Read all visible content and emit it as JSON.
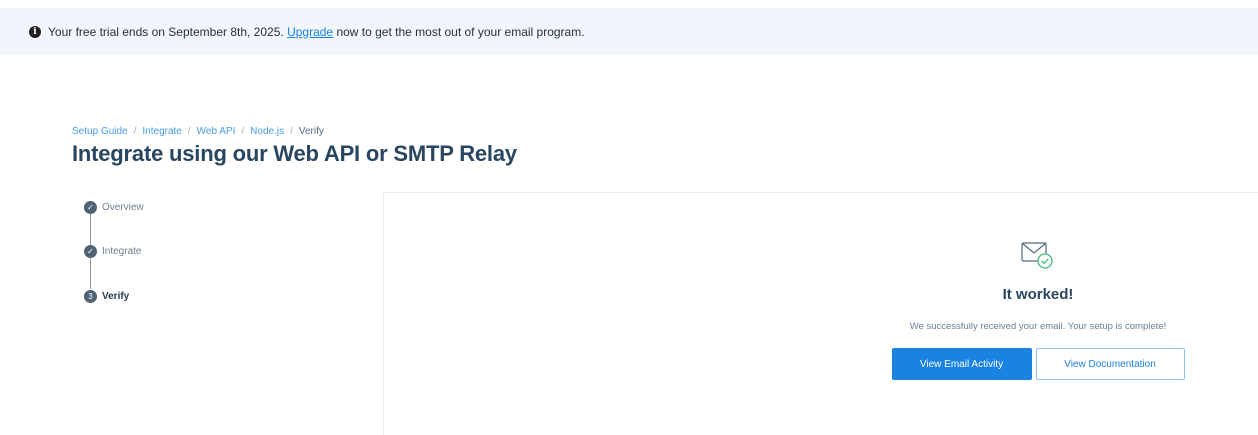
{
  "banner": {
    "icon": "info-icon",
    "text_before": "Your free trial ends on September 8th, 2025.",
    "link_label": "Upgrade",
    "text_after": "now to get the most out of your email program."
  },
  "breadcrumb": {
    "items": [
      "Setup Guide",
      "Integrate",
      "Web API",
      "Node.js"
    ],
    "current": "Verify",
    "separator": "/"
  },
  "page_title": "Integrate using our Web API or SMTP Relay",
  "stepper": {
    "steps": [
      {
        "label": "Overview",
        "state": "complete",
        "marker": "✓"
      },
      {
        "label": "Integrate",
        "state": "complete",
        "marker": "✓"
      },
      {
        "label": "Verify",
        "state": "active",
        "marker": "3"
      }
    ]
  },
  "result": {
    "icon": "mail-check-icon",
    "title": "It worked!",
    "message": "We successfully received your email. Your setup is complete!",
    "primary_button": "View Email Activity",
    "secondary_button": "View Documentation"
  },
  "colors": {
    "accent": "#1a82e2",
    "heading": "#294661",
    "banner_bg": "#f1f6fc",
    "success_green": "#3fbe7f"
  }
}
